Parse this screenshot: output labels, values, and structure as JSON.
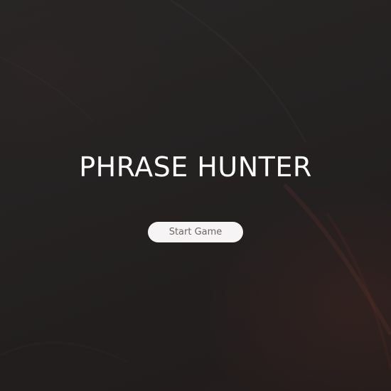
{
  "game": {
    "title": "PHRASE HUNTER",
    "start_button_label": "Start Game"
  },
  "colors": {
    "background": "#242121",
    "title_text": "#ffffff",
    "button_background": "#f6f4f4",
    "button_text": "#6f6565"
  }
}
